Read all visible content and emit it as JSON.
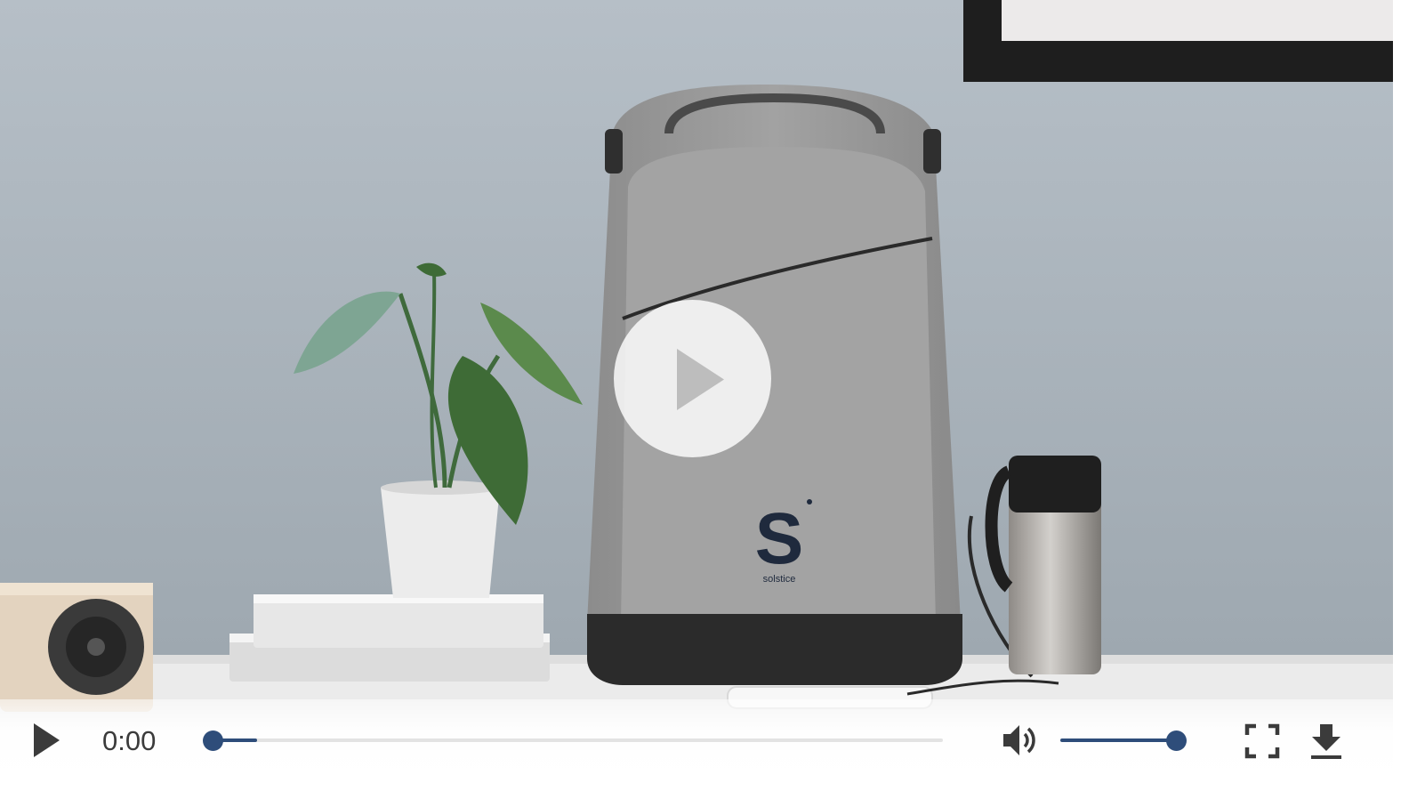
{
  "video": {
    "current_time": "0:00",
    "progress_fraction": 0.06,
    "volume_fraction": 1.0
  },
  "poster": {
    "brand_letter": "S",
    "brand_subtext": "solstice"
  },
  "icons": {
    "big_play": "play-icon",
    "play": "play-icon",
    "volume": "volume-icon",
    "fullscreen": "fullscreen-icon",
    "download": "download-icon"
  },
  "colors": {
    "accent": "#2e4d7a",
    "wall": "#aab3bb",
    "control_icon": "#3b3b3b"
  }
}
